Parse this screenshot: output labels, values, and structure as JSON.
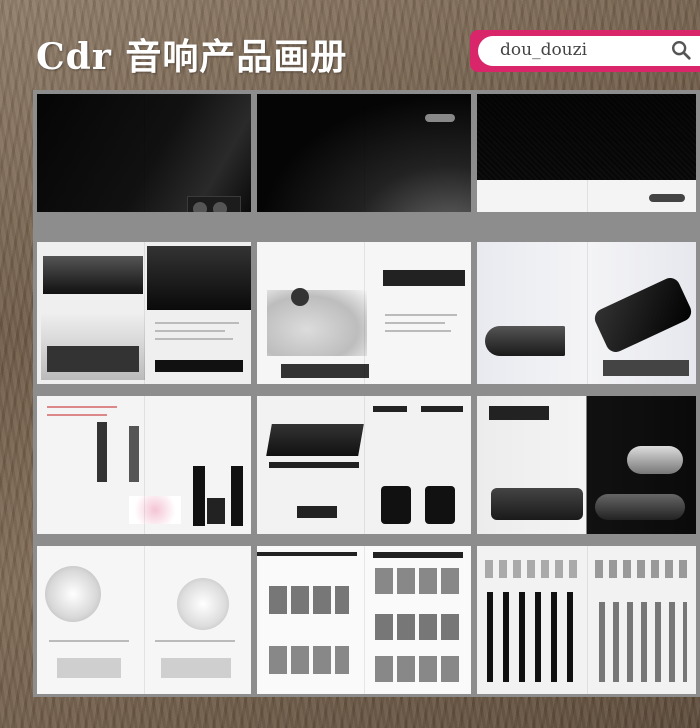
{
  "header": {
    "title": "Cdr 音响产品画册"
  },
  "search": {
    "value": "dou_douzi"
  }
}
